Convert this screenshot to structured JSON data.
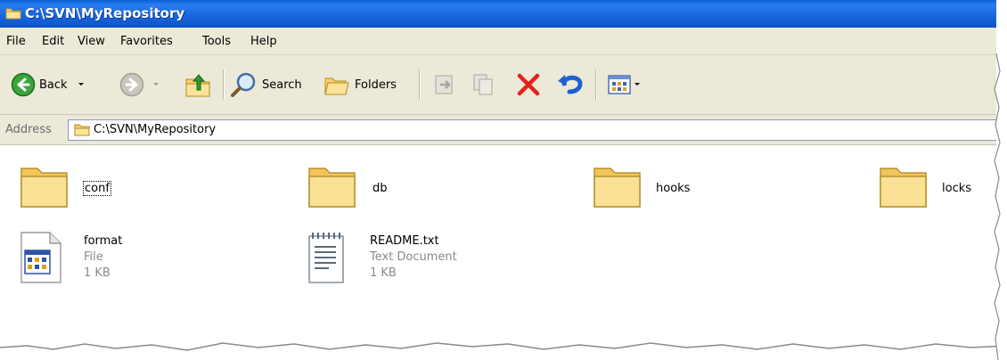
{
  "window": {
    "title": "C:\\SVN\\MyRepository"
  },
  "menu": [
    "File",
    "Edit",
    "View",
    "Favorites",
    "Tools",
    "Help"
  ],
  "toolbar": {
    "back_label": "Back",
    "search_label": "Search",
    "folders_label": "Folders"
  },
  "address": {
    "label": "Address",
    "value": "C:\\SVN\\MyRepository"
  },
  "items": {
    "conf": {
      "name": "conf"
    },
    "db": {
      "name": "db"
    },
    "hooks": {
      "name": "hooks"
    },
    "locks": {
      "name": "locks"
    },
    "format": {
      "name": "format",
      "type": "File",
      "size": "1 KB"
    },
    "readme": {
      "name": "README.txt",
      "type": "Text Document",
      "size": "1 KB"
    }
  }
}
